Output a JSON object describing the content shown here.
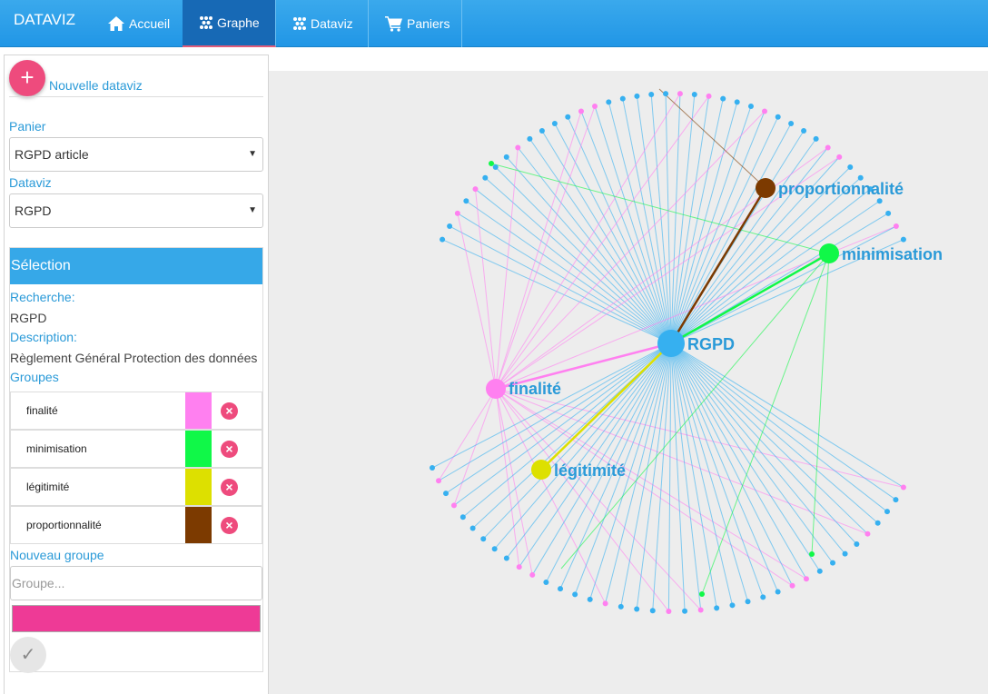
{
  "navbar": {
    "brand": "DATAVIZ",
    "items": [
      {
        "label": "Accueil",
        "icon": "home-icon",
        "active": false
      },
      {
        "label": "Graphe",
        "icon": "graph-icon",
        "active": true
      },
      {
        "label": "Dataviz",
        "icon": "graph-icon",
        "active": false
      },
      {
        "label": "Paniers",
        "icon": "cart-icon",
        "active": false
      }
    ]
  },
  "sidebar": {
    "new_dataviz_label": "Nouvelle dataviz",
    "panier_label": "Panier",
    "panier_value": "RGPD article",
    "dataviz_label": "Dataviz",
    "dataviz_value": "RGPD",
    "selection": {
      "title": "Sélection",
      "recherche_label": "Recherche:",
      "recherche_value": "RGPD",
      "description_label": "Description:",
      "description_value": "Règlement Général Protection des données",
      "groupes_label": "Groupes",
      "groups": [
        {
          "name": "finalité",
          "color": "#ff80f0"
        },
        {
          "name": "minimisation",
          "color": "#10f848"
        },
        {
          "name": "légitimité",
          "color": "#dde000"
        },
        {
          "name": "proportionnalité",
          "color": "#7c3a00"
        }
      ],
      "new_group_label": "Nouveau groupe",
      "group_placeholder": "Groupe...",
      "new_group_color": "#ee3a96"
    }
  },
  "graph": {
    "center": {
      "label": "RGPD",
      "color": "#36b0f0"
    },
    "groups": [
      {
        "label": "finalité",
        "color": "#ff80f0"
      },
      {
        "label": "minimisation",
        "color": "#10f848"
      },
      {
        "label": "légitimité",
        "color": "#dde000"
      },
      {
        "label": "proportionnalité",
        "color": "#7c3a00"
      }
    ],
    "leaf_color": "#36b0f0"
  }
}
